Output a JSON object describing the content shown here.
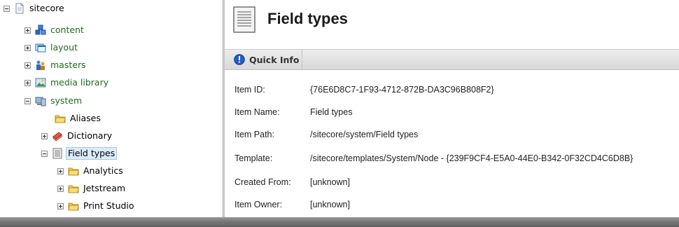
{
  "tree": {
    "root": "sitecore",
    "items": [
      {
        "label": "content"
      },
      {
        "label": "layout"
      },
      {
        "label": "masters"
      },
      {
        "label": "media library"
      },
      {
        "label": "system"
      },
      {
        "label": "Aliases"
      },
      {
        "label": "Dictionary"
      },
      {
        "label": "Field types"
      },
      {
        "label": "Analytics"
      },
      {
        "label": "Jetstream"
      },
      {
        "label": "Print Studio"
      }
    ]
  },
  "header": {
    "title": "Field types"
  },
  "quick_info": {
    "label": "Quick Info",
    "rows": [
      {
        "key": "Item ID:",
        "value": "{76E6D8C7-1F93-4712-872B-DA3C96B808F2}"
      },
      {
        "key": "Item Name:",
        "value": "Field types"
      },
      {
        "key": "Item Path:",
        "value": "/sitecore/system/Field types"
      },
      {
        "key": "Template:",
        "value": "/sitecore/templates/System/Node - {239F9CF4-E5A0-44E0-B342-0F32CD4C6D8B}"
      },
      {
        "key": "Created From:",
        "value": "[unknown]"
      },
      {
        "key": "Item Owner:",
        "value": "[unknown]"
      }
    ]
  },
  "colors": {
    "tree_link": "#1f6b1f",
    "selection": "#dcecfb"
  }
}
